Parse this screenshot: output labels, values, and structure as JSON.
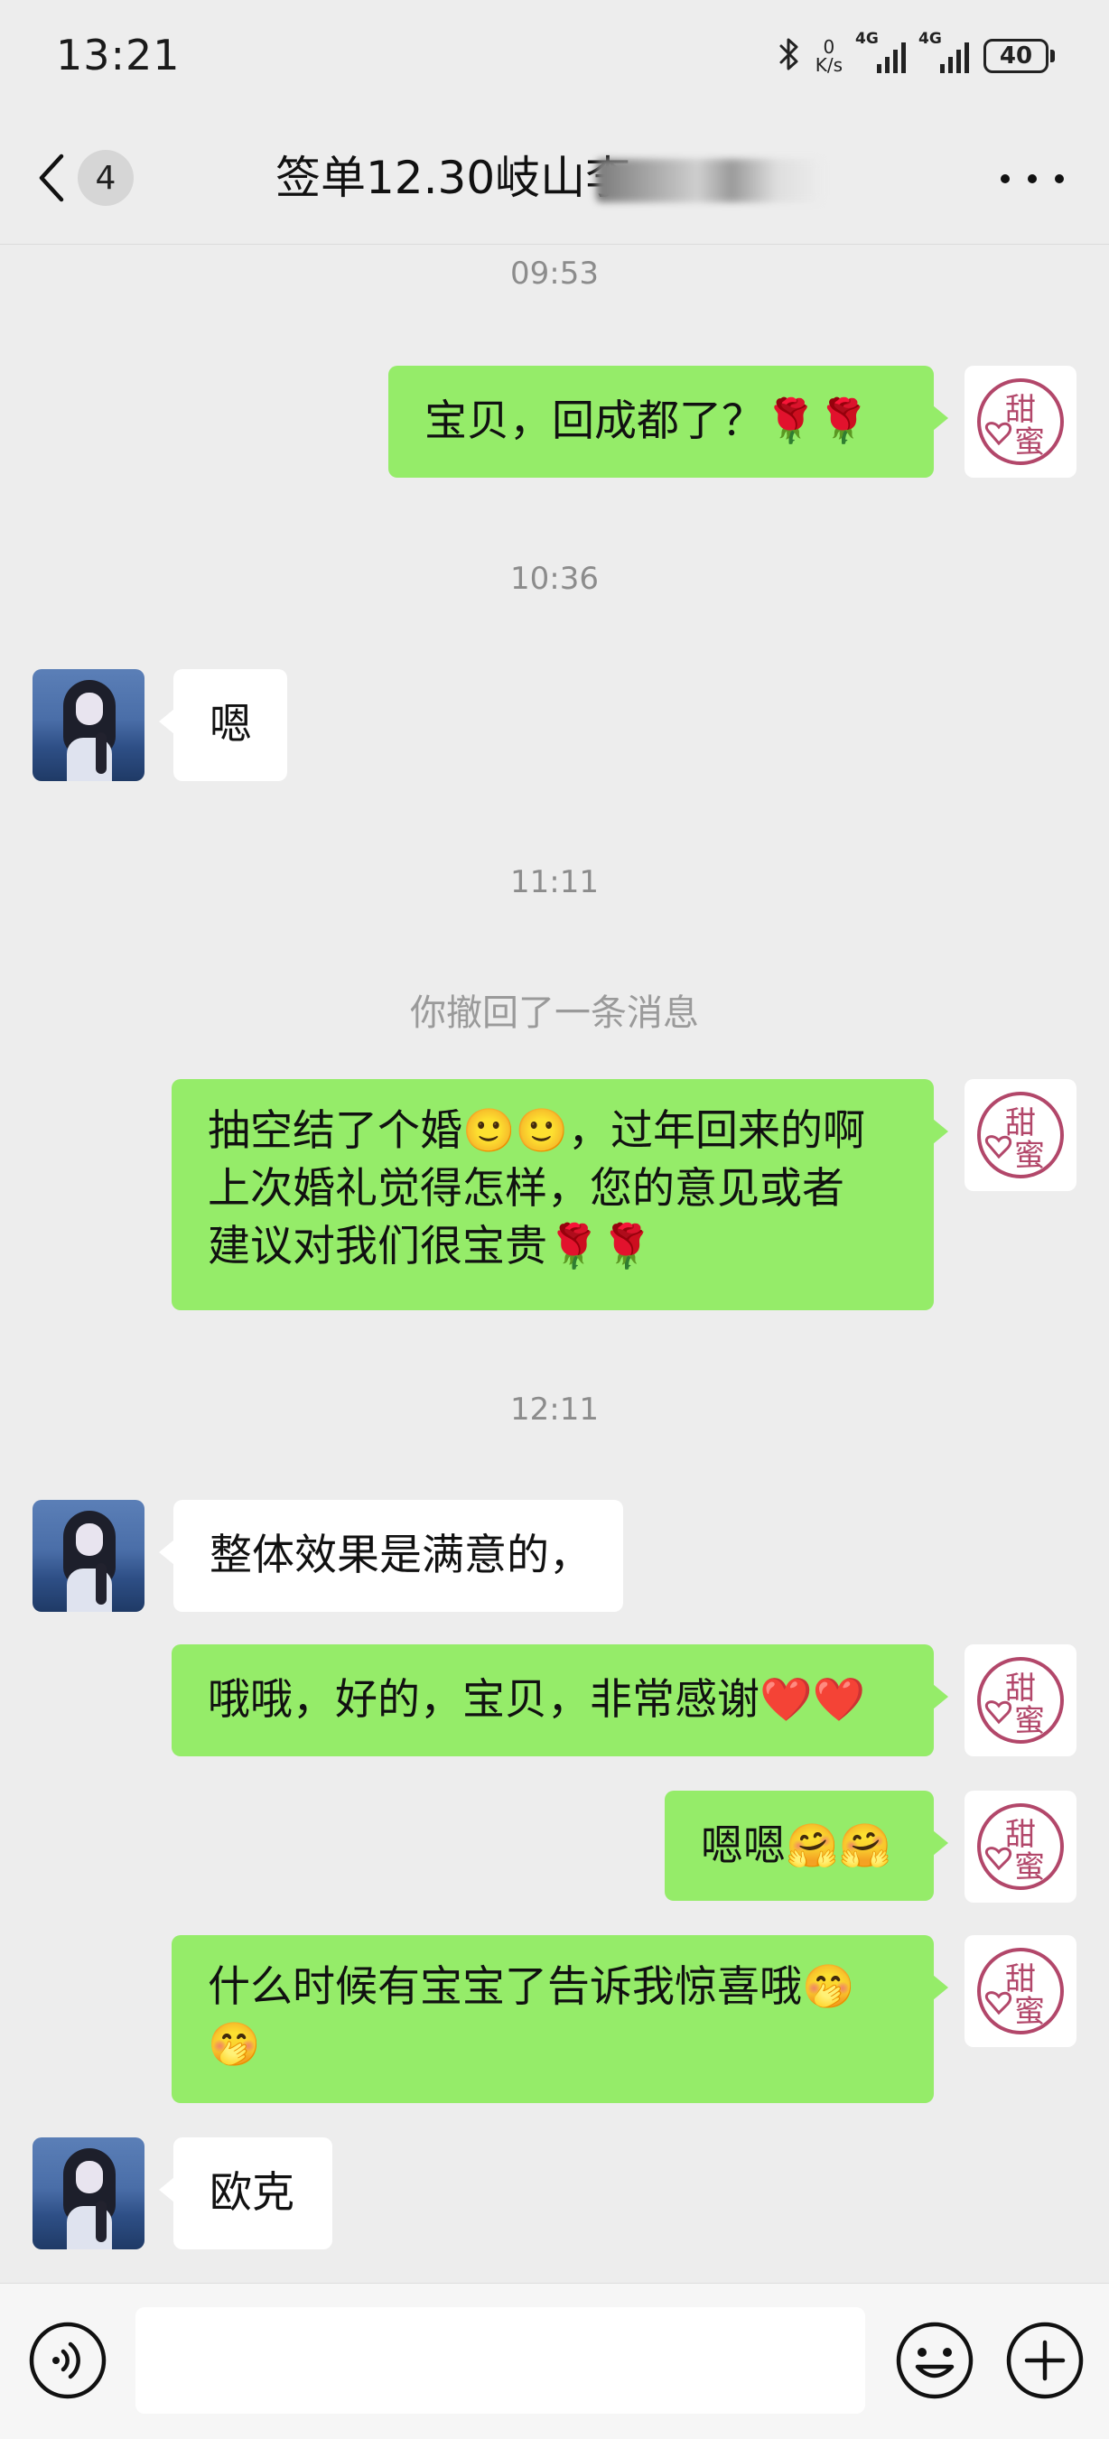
{
  "status_bar": {
    "time": "13:21",
    "net_speed_value": "0",
    "net_speed_unit": "K/s",
    "signal_label_1": "4G",
    "signal_label_2": "4G",
    "battery": "40"
  },
  "header": {
    "back_badge": "4",
    "title": "签单12.30岐山李"
  },
  "messages": [
    {
      "kind": "time",
      "text": "09:53"
    },
    {
      "kind": "bubble",
      "side": "mine",
      "lines": [
        "宝贝，回成都了？🌹🌹"
      ]
    },
    {
      "kind": "time",
      "text": "10:36"
    },
    {
      "kind": "bubble",
      "side": "theirs",
      "lines": [
        "嗯"
      ]
    },
    {
      "kind": "time",
      "text": "11:11"
    },
    {
      "kind": "system",
      "text": "你撤回了一条消息"
    },
    {
      "kind": "bubble",
      "side": "mine",
      "lines": [
        "抽空结了个婚🙂🙂，过年回来的啊",
        "上次婚礼觉得怎样，您的意见或者",
        "建议对我们很宝贵🌹🌹"
      ]
    },
    {
      "kind": "time",
      "text": "12:11"
    },
    {
      "kind": "bubble",
      "side": "theirs",
      "lines": [
        "整体效果是满意的，"
      ]
    },
    {
      "kind": "bubble",
      "side": "mine",
      "lines": [
        "哦哦，好的，宝贝，非常感谢❤️❤️"
      ]
    },
    {
      "kind": "bubble",
      "side": "mine",
      "lines": [
        "嗯嗯🤗🤗"
      ]
    },
    {
      "kind": "bubble",
      "side": "mine",
      "lines": [
        "什么时候有宝宝了告诉我惊喜哦🤭",
        "🤭"
      ]
    },
    {
      "kind": "bubble",
      "side": "theirs",
      "lines": [
        "欧克"
      ]
    }
  ],
  "logo_avatar": {
    "char_top": "甜",
    "char_bottom": "蜜",
    "color": "#b2476a"
  },
  "input_bar": {
    "placeholder": "",
    "voice_icon": "voice-icon",
    "emoji_icon": "emoji-icon",
    "plus_icon": "plus-icon"
  },
  "colors": {
    "background": "#ededed",
    "mine_bubble": "#95ec69",
    "theirs_bubble": "#ffffff",
    "timestamp": "#8c8c8c"
  }
}
